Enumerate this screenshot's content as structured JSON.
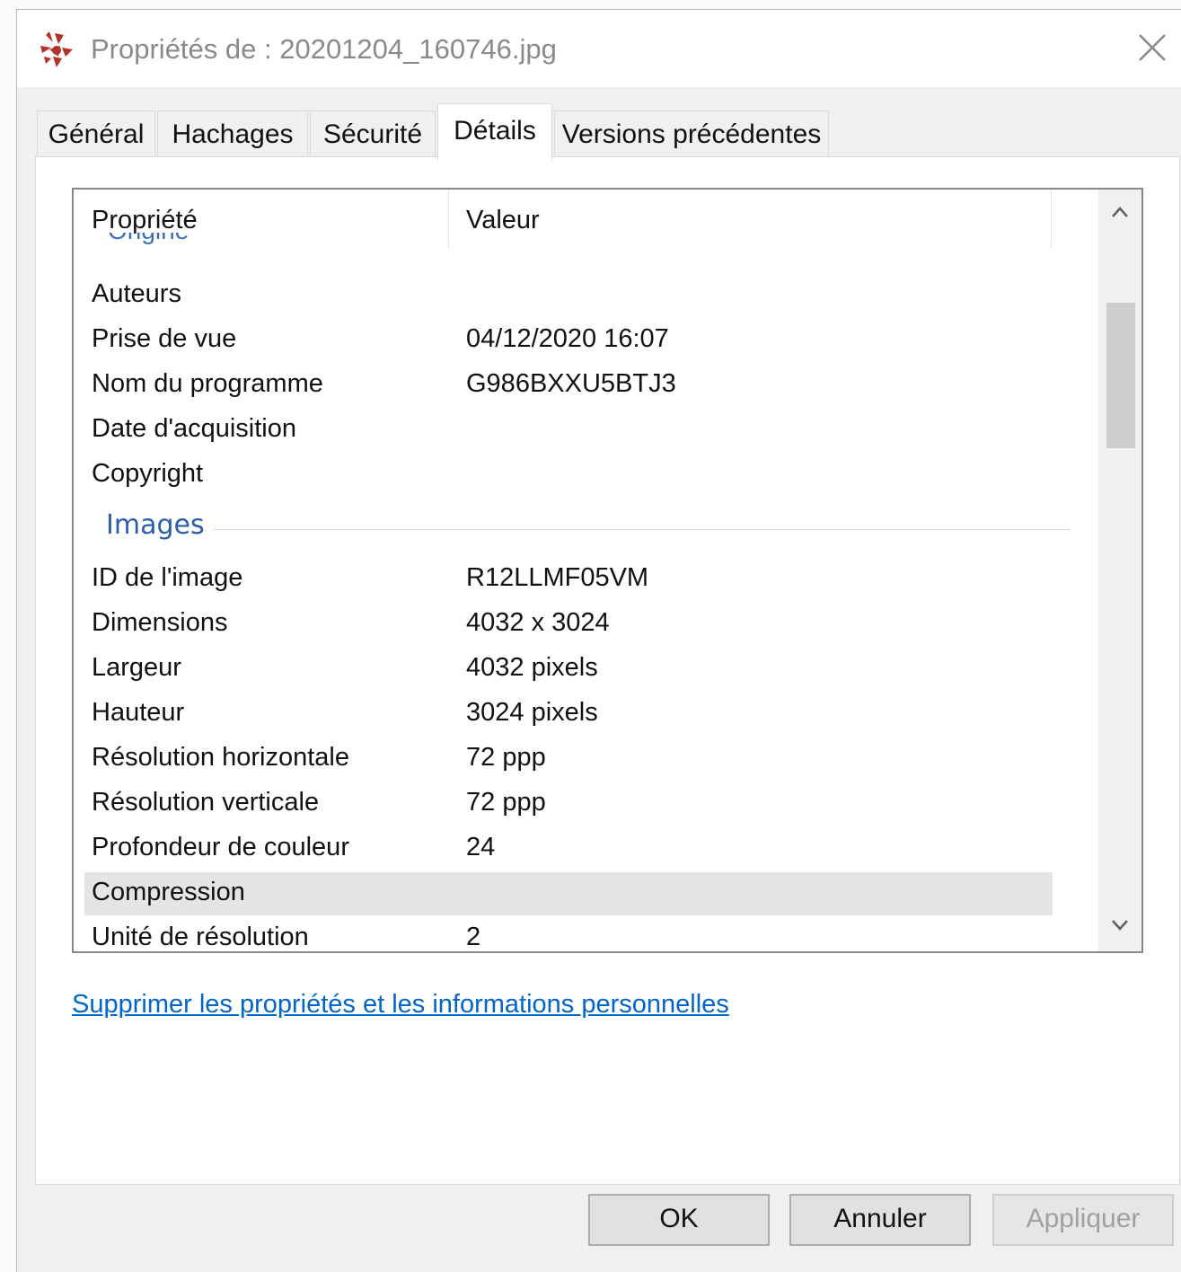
{
  "window": {
    "title": "Propriétés de : 20201204_160746.jpg"
  },
  "tabs": [
    {
      "label": "Général"
    },
    {
      "label": "Hachages"
    },
    {
      "label": "Sécurité"
    },
    {
      "label": "Détails",
      "active": true
    },
    {
      "label": "Versions précédentes"
    }
  ],
  "details": {
    "columns": {
      "property": "Propriété",
      "value": "Valeur"
    },
    "partial_group": "Origine",
    "origin_rows": [
      {
        "name": "Auteurs",
        "value": ""
      },
      {
        "name": "Prise de vue",
        "value": "04/12/2020 16:07"
      },
      {
        "name": "Nom du programme",
        "value": "G986BXXU5BTJ3"
      },
      {
        "name": "Date d'acquisition",
        "value": ""
      },
      {
        "name": "Copyright",
        "value": ""
      }
    ],
    "images_group": "Images",
    "image_rows": [
      {
        "name": "ID de l'image",
        "value": "R12LLMF05VM"
      },
      {
        "name": "Dimensions",
        "value": "4032 x 3024"
      },
      {
        "name": "Largeur",
        "value": "4032 pixels"
      },
      {
        "name": "Hauteur",
        "value": "3024 pixels"
      },
      {
        "name": "Résolution horizontale",
        "value": "72 ppp"
      },
      {
        "name": "Résolution verticale",
        "value": "72 ppp"
      },
      {
        "name": "Profondeur de couleur",
        "value": "24"
      },
      {
        "name": "Compression",
        "value": "",
        "selected": true
      },
      {
        "name": "Unité de résolution",
        "value": "2"
      }
    ]
  },
  "link": {
    "remove_properties": "Supprimer les propriétés et les informations personnelles"
  },
  "buttons": {
    "ok": "OK",
    "cancel": "Annuler",
    "apply": "Appliquer"
  },
  "colors": {
    "link": "#0066cc",
    "group_header": "#2a5fa8",
    "app_icon": "#b5312b"
  },
  "icons": {
    "app": "app-icon",
    "close": "close-icon",
    "scroll_up": "chevron-up-icon",
    "scroll_down": "chevron-down-icon"
  }
}
